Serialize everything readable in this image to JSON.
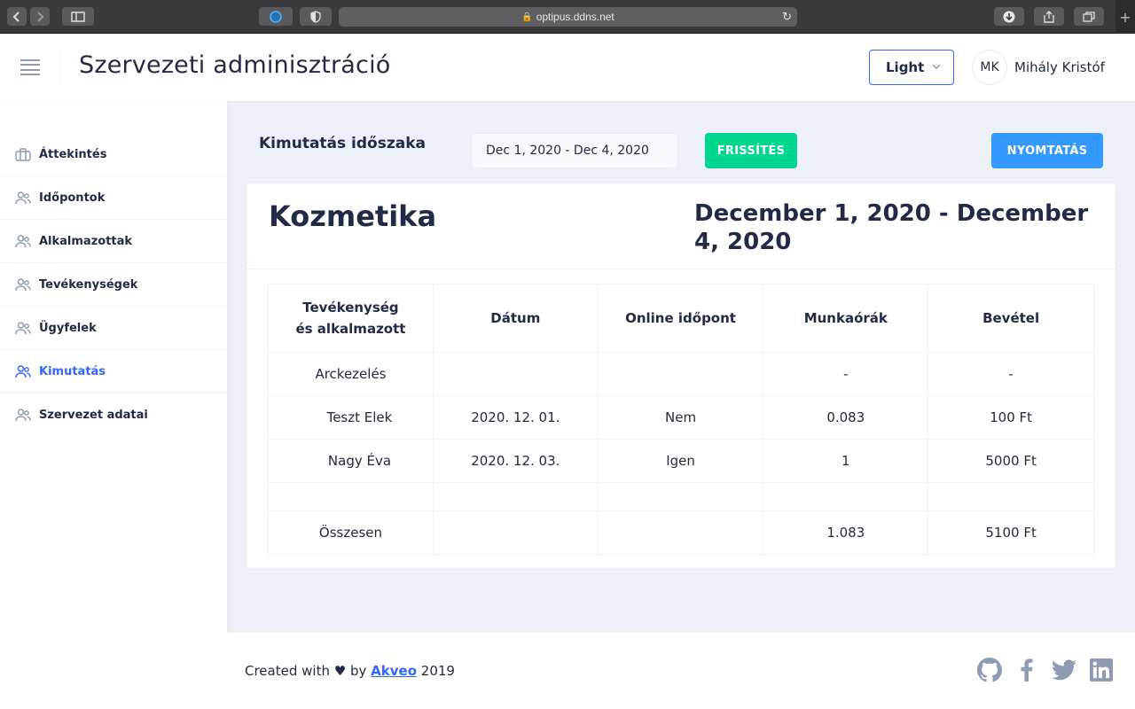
{
  "browser": {
    "url": "optipus.ddns.net"
  },
  "header": {
    "title": "Szervezeti adminisztráció",
    "theme_selected": "Light",
    "user_initials": "MK",
    "user_name": "Mihály Kristóf"
  },
  "sidebar": {
    "items": [
      {
        "label": "Áttekintés",
        "icon": "briefcase-icon"
      },
      {
        "label": "Időpontok",
        "icon": "people-icon"
      },
      {
        "label": "Alkalmazottak",
        "icon": "people-icon"
      },
      {
        "label": "Tevékenységek",
        "icon": "people-icon"
      },
      {
        "label": "Ügyfelek",
        "icon": "people-icon"
      },
      {
        "label": "Kimutatás",
        "icon": "people-icon",
        "active": true
      },
      {
        "label": "Szervezet adatai",
        "icon": "people-icon"
      }
    ]
  },
  "toolbar": {
    "period_label": "Kimutatás időszaka",
    "date_range_value": "Dec 1, 2020 - Dec 4, 2020",
    "refresh_label": "FRISSÍTÉS",
    "print_label": "NYOMTATÁS"
  },
  "report": {
    "title": "Kozmetika",
    "range": "December 1, 2020 - December 4, 2020",
    "columns": [
      "Tevékenység és alkalmazott",
      "Dátum",
      "Online időpont",
      "Munkaórák",
      "Bevétel"
    ],
    "rows": [
      [
        "Arckezelés",
        "",
        "",
        "-",
        "-"
      ],
      [
        "Teszt Elek",
        "2020. 12. 01.",
        "Nem",
        "0.083",
        "100 Ft"
      ],
      [
        "Nagy Éva",
        "2020. 12. 03.",
        "Igen",
        "1",
        "5000 Ft"
      ]
    ],
    "total": [
      "Összesen",
      "",
      "",
      "1.083",
      "5100 Ft"
    ]
  },
  "footer": {
    "prefix": "Created with",
    "by": "by",
    "link": "Akveo",
    "year": "2019"
  },
  "colors": {
    "primary": "#3366ff",
    "success": "#00d68f",
    "info": "#3399ff",
    "text": "#222b45",
    "hint": "#8f9bb3"
  }
}
